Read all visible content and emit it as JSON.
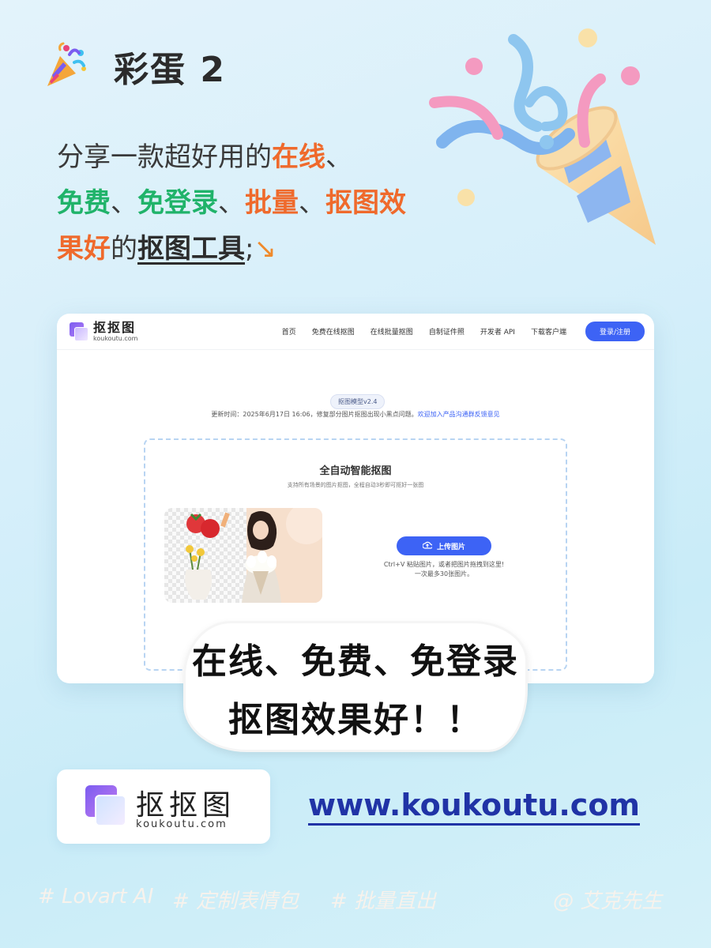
{
  "header": {
    "title": "彩蛋 2",
    "icon": "party-popper-icon"
  },
  "intro": {
    "p1": "分享一款超好用的",
    "p2": "在线",
    "p3": "、",
    "p4": "免费",
    "p5": "、",
    "p6": "免登录",
    "p7": "、",
    "p8": "批量",
    "p9": "、",
    "p10": "抠图效果好",
    "p11": "的",
    "p12": "抠图工具",
    "p13": ";",
    "arrow": "↘"
  },
  "site": {
    "logo_cn": "抠抠图",
    "logo_en": "koukoutu.com",
    "nav": [
      "首页",
      "免费在线抠图",
      "在线批量抠图",
      "自制证件照",
      "开发者 API",
      "下载客户端"
    ],
    "login": "登录/注册",
    "model_version": "抠图模型v2.4",
    "update_text": "更新时间：2025年6月17日 16:06，修复部分图片抠图出现小黑点问题。",
    "update_link": "欢迎加入产品沟通群反馈意见",
    "dropzone_title": "全自动智能抠图",
    "dropzone_sub": "支持所有场景的图片抠图，全程自动3秒即可抠好一张图",
    "upload_label": "上传图片",
    "upload_hint1": "Ctrl+V 粘贴图片，或者把图片拖拽到这里!",
    "upload_hint2": "一次最多30张图片。"
  },
  "sticker": {
    "line1": "在线、免费、免登录",
    "line2": "抠图效果好！！"
  },
  "footer": {
    "logo_cn": "抠抠图",
    "logo_en": "koukoutu.com",
    "url": "www.koukoutu.com",
    "tags": [
      "# Lovart AI",
      "# 定制表情包",
      "# 批量直出",
      "@ 艾克先生"
    ]
  },
  "colors": {
    "accent": "#3d63f5",
    "orange": "#ef6a2c",
    "green": "#20b36a",
    "url_blue": "#2033a6"
  }
}
